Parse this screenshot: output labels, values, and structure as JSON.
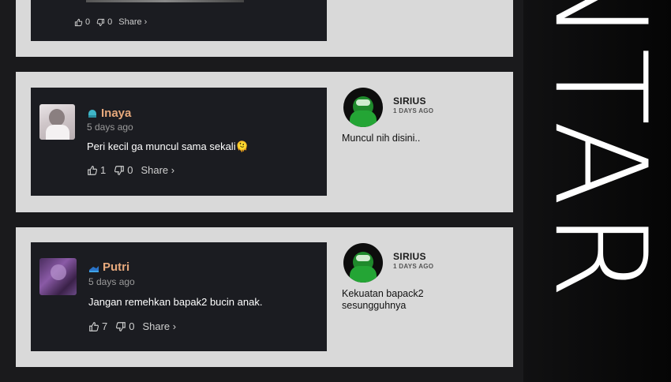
{
  "side_title": "NTAR",
  "top_card": {
    "likes": "0",
    "dislikes": "0",
    "share_label": "Share ›"
  },
  "comments": [
    {
      "name": "Inaya",
      "time": "5 days ago",
      "message": "Peri kecil ga muncul sama sekali🫠",
      "likes": "1",
      "dislikes": "0",
      "share_label": "Share ›",
      "reply": {
        "name": "SIRIUS",
        "time": "1 DAYS AGO",
        "text": "Muncul nih disini.."
      }
    },
    {
      "name": "Putri",
      "time": "5 days ago",
      "message": "Jangan remehkan bapak2 bucin anak.",
      "likes": "7",
      "dislikes": "0",
      "share_label": "Share ›",
      "reply": {
        "name": "SIRIUS",
        "time": "1 DAYS AGO",
        "text": "Kekuatan bapack2 sesungguhnya"
      }
    }
  ],
  "colors": {
    "panel": "#d9d9d9",
    "card": "#1b1c21",
    "username": "#e7a97c",
    "sidebar": "#0a0a0a"
  }
}
